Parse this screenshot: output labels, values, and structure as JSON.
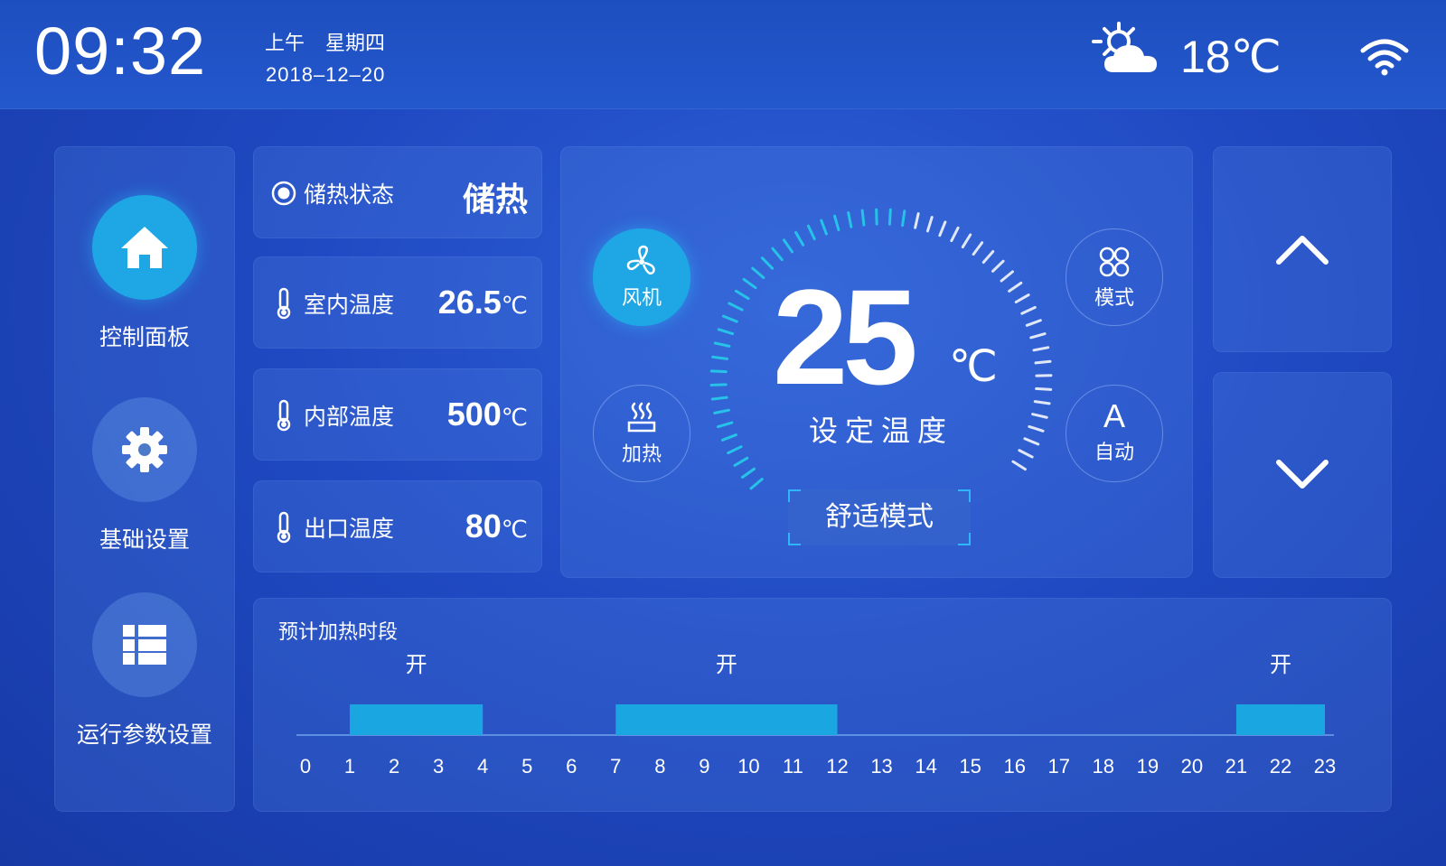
{
  "status_bar": {
    "time": "09:32",
    "ampm": "上午",
    "weekday": "星期四",
    "date": "2018–12–20",
    "weather_icon": "partly-cloudy-icon",
    "outdoor_temp": "18℃",
    "wifi_icon": "wifi-icon"
  },
  "nav": {
    "items": [
      {
        "label": "控制面板",
        "icon": "home-icon",
        "active": true
      },
      {
        "label": "基础设置",
        "icon": "gear-icon",
        "active": false
      },
      {
        "label": "运行参数设置",
        "icon": "list-grid-icon",
        "active": false
      }
    ]
  },
  "stats": [
    {
      "label": "储热状态",
      "value": "储热",
      "unit": "",
      "icon": "radio-dot-icon"
    },
    {
      "label": "室内温度",
      "value": "26.5",
      "unit": "℃",
      "icon": "thermometer-icon"
    },
    {
      "label": "内部温度",
      "value": "500",
      "unit": "℃",
      "icon": "thermometer-icon"
    },
    {
      "label": "出口温度",
      "value": "80",
      "unit": "℃",
      "icon": "thermometer-icon"
    }
  ],
  "control": {
    "fan_label": "风机",
    "heat_label": "加热",
    "mode_label": "模式",
    "auto_letter": "A",
    "auto_label": "自动",
    "setpoint_value": "25",
    "setpoint_unit": "℃",
    "setpoint_label": "设定温度",
    "comfort_mode": "舒适模式"
  },
  "arrows": {
    "up_icon": "chevron-up-icon",
    "down_icon": "chevron-down-icon"
  },
  "schedule": {
    "title": "预计加热时段",
    "hours": [
      "0",
      "1",
      "2",
      "3",
      "4",
      "5",
      "6",
      "7",
      "8",
      "9",
      "10",
      "11",
      "12",
      "13",
      "14",
      "15",
      "16",
      "17",
      "18",
      "19",
      "20",
      "21",
      "22",
      "23"
    ],
    "blocks": [
      {
        "start": 1,
        "end": 4,
        "label": "开"
      },
      {
        "start": 7,
        "end": 12,
        "label": "开"
      },
      {
        "start": 21,
        "end": 23,
        "label": "开"
      }
    ]
  },
  "colors": {
    "accent": "#1ea7e4",
    "bar": "#1aa6e0",
    "background": "#1f49c2"
  }
}
